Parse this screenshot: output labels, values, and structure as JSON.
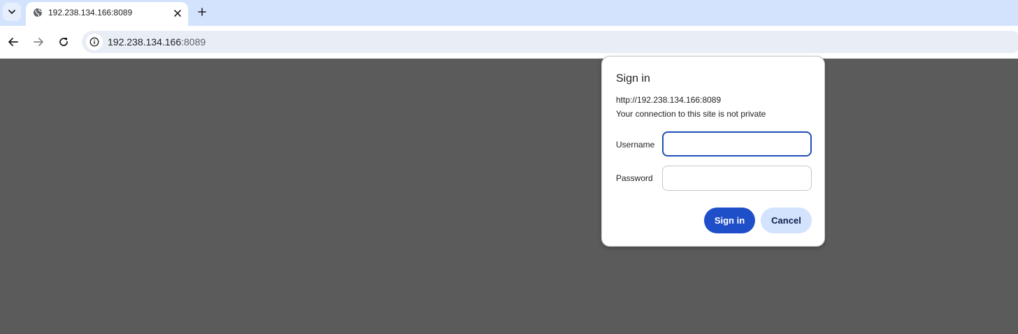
{
  "browser": {
    "tab": {
      "title": "192.238.134.166:8089"
    },
    "address_bar": {
      "host": "192.238.134.166",
      "port": ":8089"
    }
  },
  "dialog": {
    "title": "Sign in",
    "origin": "http://192.238.134.166:8089",
    "warning": "Your connection to this site is not private",
    "username_label": "Username",
    "username_value": "",
    "password_label": "Password",
    "password_value": "",
    "signin_label": "Sign in",
    "cancel_label": "Cancel"
  },
  "colors": {
    "tabbar_bg": "#d3e3fd",
    "page_bg": "#5b5b5b",
    "primary_button": "#1f4fc8",
    "secondary_button": "#d3e3fd",
    "focus_border": "#1f4fb6"
  },
  "icons": [
    "tab-search-icon",
    "globe-icon",
    "close-icon",
    "plus-icon",
    "back-arrow-icon",
    "forward-arrow-icon",
    "reload-icon",
    "info-icon"
  ]
}
